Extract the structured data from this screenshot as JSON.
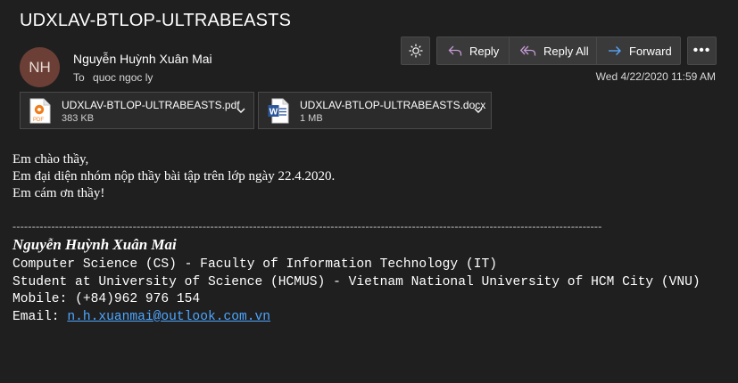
{
  "email": {
    "subject": "UDXLAV-BTLOP-ULTRABEASTS",
    "avatar_initials": "NH",
    "sender": "Nguyễn Huỳnh Xuân Mai",
    "to_label": "To",
    "to": "quoc ngoc ly",
    "date": "Wed 4/22/2020 11:59 AM"
  },
  "toolbar": {
    "sun_icon": "sun-icon",
    "reply_label": "Reply",
    "reply_all_label": "Reply All",
    "forward_label": "Forward",
    "more_label": "•••"
  },
  "attachments": [
    {
      "name": "UDXLAV-BTLOP-ULTRABEASTS.pdf",
      "size": "383 KB",
      "icon": "pdf-file-icon"
    },
    {
      "name": "UDXLAV-BTLOP-ULTRABEASTS.docx",
      "size": "1 MB",
      "icon": "word-file-icon"
    }
  ],
  "body": {
    "line1": "Em chào thầy,",
    "line2": "Em đại diện nhóm nộp thầy bài tập trên lớp ngày 22.4.2020.",
    "line3": "Em cám ơn thầy!"
  },
  "signature": {
    "divider": "--------------------------------------------------------------------------------------------------------------------------------------------------------",
    "name": "Nguyễn Huỳnh Xuân Mai",
    "line1": "Computer Science (CS) - Faculty of Information Technology (IT)",
    "line2": "Student at University of Science (HCMUS) - Vietnam National University of HCM City (VNU)",
    "mobile_label": "Mobile: ",
    "mobile": "(+84)962 976 154",
    "email_label": "Email: ",
    "email": "n.h.xuanmai@outlook.com.vn"
  },
  "colors": {
    "background": "#1f1f1f",
    "link": "#4ea6ff",
    "accent": "#8ab4f8",
    "avatar": "#6b3f36"
  }
}
